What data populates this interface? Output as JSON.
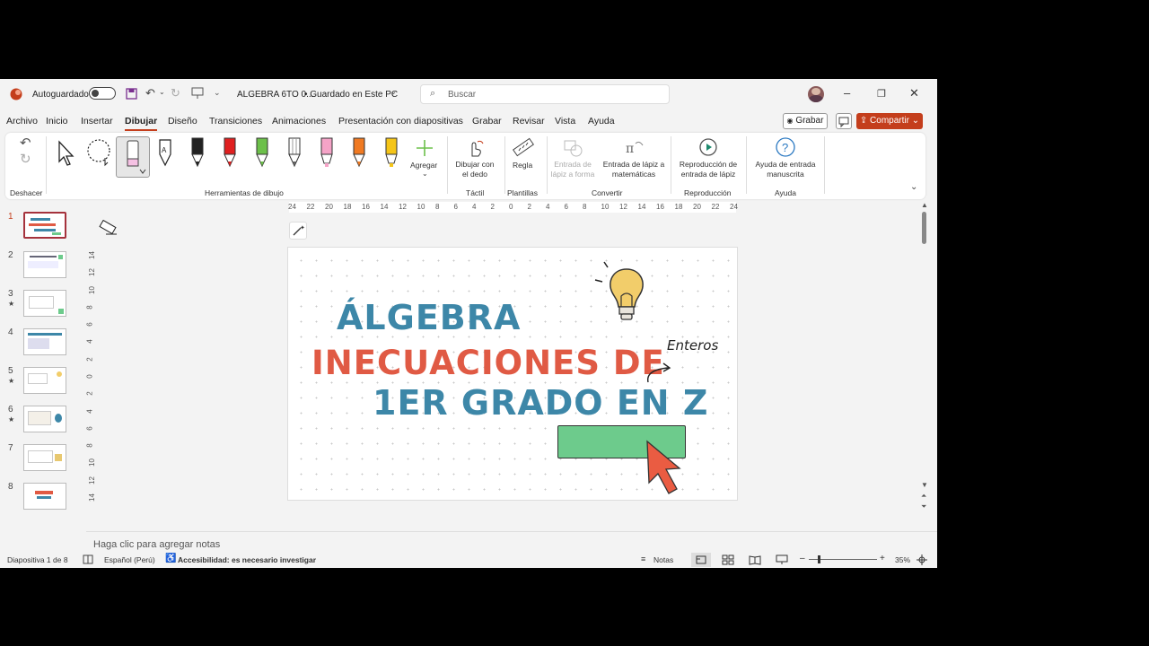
{
  "titlebar": {
    "autosave_label": "Autoguardado",
    "filename": "ALGEBRA 6TO 0...",
    "save_status": "• Guardado en Este PC",
    "search_placeholder": "Buscar"
  },
  "menu": [
    "Archivo",
    "Inicio",
    "Insertar",
    "Dibujar",
    "Diseño",
    "Transiciones",
    "Animaciones",
    "Presentación con diapositivas",
    "Grabar",
    "Revisar",
    "Vista",
    "Ayuda"
  ],
  "menu_active": "Dibujar",
  "actions": {
    "grabar": "Grabar",
    "compartir": "Compartir"
  },
  "ribbon": {
    "deshacer_group": "Deshacer",
    "tools_group": "Herramientas de dibujo",
    "agregar": "Agregar",
    "dibujar_dedo": "Dibujar con el dedo",
    "tactil_group": "Táctil",
    "regla": "Regla",
    "plantillas_group": "Plantillas",
    "entrada_forma": "Entrada de lápiz a forma",
    "entrada_mate": "Entrada de lápiz a matemáticas",
    "convertir_group": "Convertir",
    "reproduccion_btn": "Reproducción de entrada de lápiz",
    "reproduccion_group": "Reproducción",
    "ayuda_btn": "Ayuda de entrada manuscrita",
    "ayuda_group": "Ayuda",
    "pen_colors": [
      "#222222",
      "#e02020",
      "#6cc04a",
      "#666666",
      "#f5a3c7",
      "#f07a22",
      "#f5c518"
    ]
  },
  "ruler": {
    "h": [
      "24",
      "22",
      "20",
      "18",
      "16",
      "14",
      "12",
      "10",
      "8",
      "6",
      "4",
      "2",
      "0",
      "2",
      "4",
      "6",
      "8",
      "10",
      "12",
      "14",
      "16",
      "18",
      "20",
      "22",
      "24"
    ],
    "v": [
      "14",
      "12",
      "10",
      "8",
      "6",
      "4",
      "2",
      "0",
      "2",
      "4",
      "6",
      "8",
      "10",
      "12",
      "14"
    ]
  },
  "slides": [
    "1",
    "2",
    "3",
    "4",
    "5",
    "6",
    "7",
    "8"
  ],
  "slide": {
    "line1": "ÁLGEBRA",
    "line2": "INECUACIONES DE",
    "line3": "1ER GRADO EN Z",
    "annotation": "Enteros",
    "colors": {
      "teal": "#3d87a8",
      "coral": "#e05a44",
      "green": "#6dcb8c",
      "cursor": "#ea5c42",
      "bulb": "#f2cd6a"
    }
  },
  "notes_placeholder": "Haga clic para agregar notas",
  "status": {
    "slide_count": "Diapositiva 1 de 8",
    "language": "Español (Perú)",
    "accessibility": "Accesibilidad: es necesario investigar",
    "notes": "Notas",
    "zoom": "35%"
  }
}
